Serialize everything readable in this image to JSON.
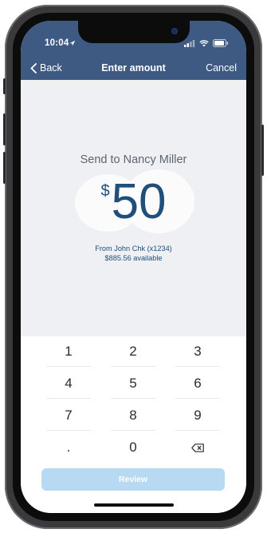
{
  "status_bar": {
    "time": "10:04"
  },
  "nav": {
    "back_label": "Back",
    "title": "Enter amount",
    "cancel_label": "Cancel"
  },
  "amount": {
    "recipient_line": "Send to Nancy Miller",
    "currency_symbol": "$",
    "value": "50",
    "from_account": "From John Chk (x1234)",
    "available": "$885.56 available"
  },
  "keypad": {
    "keys": [
      "1",
      "2",
      "3",
      "4",
      "5",
      "6",
      "7",
      "8",
      "9",
      ".",
      "0"
    ],
    "delete_icon": "backspace-icon"
  },
  "review_button": {
    "label": "Review",
    "enabled": false
  },
  "colors": {
    "header": "#3e5a82",
    "amount_text": "#1f4f7a",
    "review_disabled": "#b8d9f2"
  }
}
